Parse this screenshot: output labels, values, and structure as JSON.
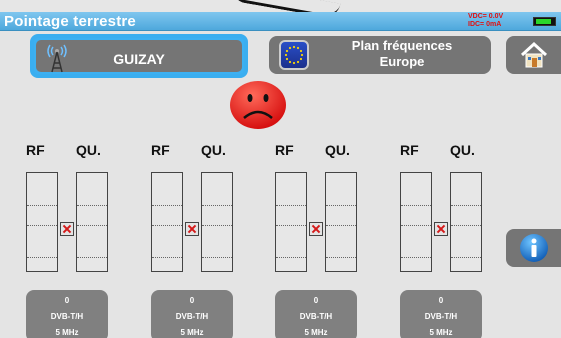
{
  "window": {
    "title": "Pointage terrestre"
  },
  "status": {
    "vdc": "VDC= 0.0V",
    "idc": "IDC=  0mA",
    "battery_level": 0.65
  },
  "site": {
    "name": "GUIZAY"
  },
  "plan": {
    "line1": "Plan fréquences",
    "line2": "Europe"
  },
  "channels": [
    {
      "rf_label": "RF",
      "qu_label": "QU.",
      "value": "0",
      "standard": "DVB-T/H",
      "bandwidth": "5 MHz"
    },
    {
      "rf_label": "RF",
      "qu_label": "QU.",
      "value": "0",
      "standard": "DVB-T/H",
      "bandwidth": "5 MHz"
    },
    {
      "rf_label": "RF",
      "qu_label": "QU.",
      "value": "0",
      "standard": "DVB-T/H",
      "bandwidth": "5 MHz"
    },
    {
      "rf_label": "RF",
      "qu_label": "QU.",
      "value": "0",
      "standard": "DVB-T/H",
      "bandwidth": "5 MHz"
    }
  ],
  "colors": {
    "accent": "#3cb0f2",
    "button": "#757575",
    "status_red": "#e01010",
    "smiley": "#e62020"
  },
  "icons": {
    "site": "antenna-icon",
    "plan": "eu-flag-icon",
    "home": "home-icon",
    "info": "info-icon",
    "status": "sad-face-icon"
  }
}
